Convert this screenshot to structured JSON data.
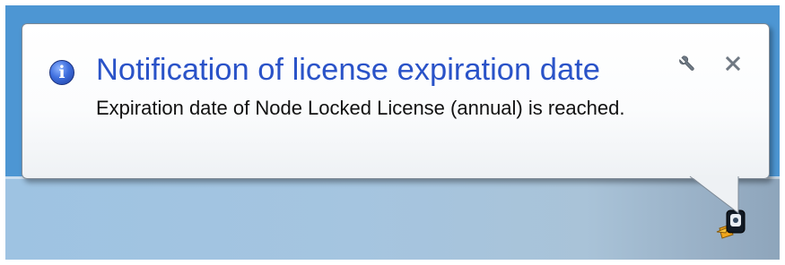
{
  "notification": {
    "title": "Notification of license expiration date",
    "message": "Expiration date of Node Locked License (annual) is reached.",
    "icon": "info-icon",
    "options_icon": "wrench-icon",
    "close_icon": "close-icon"
  },
  "tray": {
    "icon": "license-manager-tray-icon"
  },
  "colors": {
    "desktop": "#4d96d3",
    "title": "#2a53c8",
    "message": "#111111",
    "taskbar": "#a5c5e0"
  }
}
